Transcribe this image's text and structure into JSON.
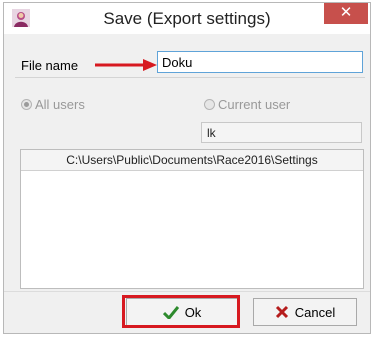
{
  "dialog": {
    "title": "Save (Export settings)",
    "close_glyph": "✕"
  },
  "file": {
    "label": "File name",
    "value": "Doku"
  },
  "options": {
    "all_users": "All users",
    "current_user": "Current user",
    "user_value": "lk",
    "selected": "all_users"
  },
  "path": {
    "text": "C:\\Users\\Public\\Documents\\Race2016\\Settings"
  },
  "buttons": {
    "ok": "Ok",
    "cancel": "Cancel"
  },
  "icons": {
    "app": "avatar-icon",
    "ok": "checkmark-icon",
    "cancel": "x-icon",
    "annotation": "red-arrow-icon"
  },
  "colors": {
    "annotation": "#d71920",
    "close": "#c7504c",
    "ok_check": "#2d8a2d",
    "cancel_x": "#b51c1c"
  }
}
